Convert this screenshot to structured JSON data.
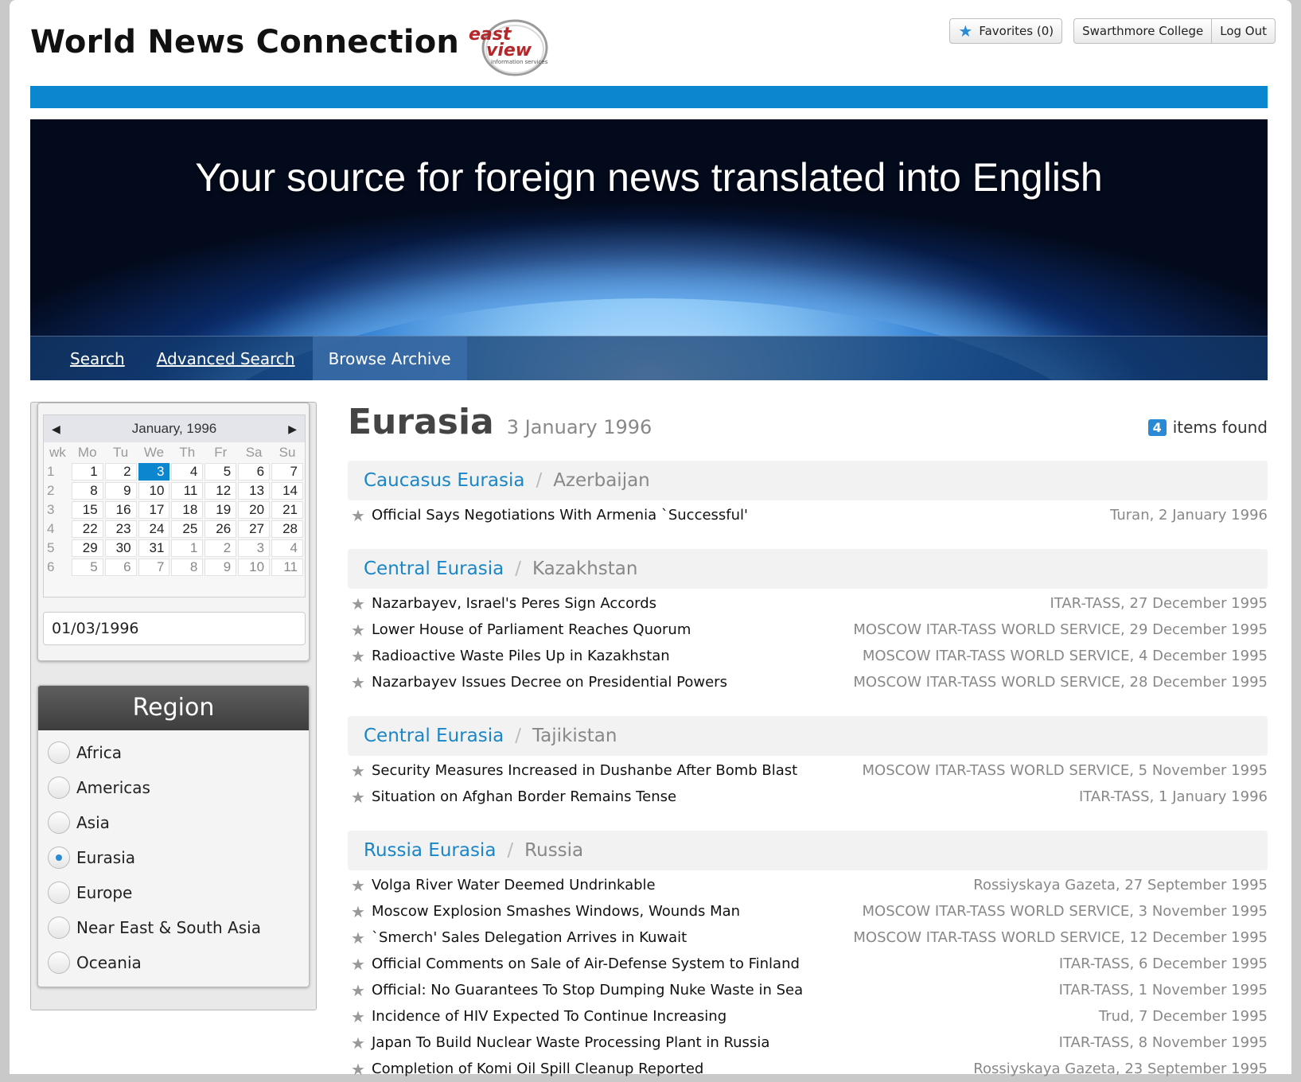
{
  "header": {
    "site_title": "World News Connection",
    "logo_text_1": "east",
    "logo_text_2": "view",
    "logo_text_3": "information services",
    "favorites_label": "Favorites (0)",
    "institution_label": "Swarthmore College",
    "logout_label": "Log Out"
  },
  "banner": {
    "tagline": "Your source for foreign news translated into English"
  },
  "nav": {
    "search": "Search",
    "advanced_search": "Advanced Search",
    "browse_archive": "Browse Archive"
  },
  "calendar": {
    "month_label": "January, 1996",
    "prev_icon": "triangle-left-icon",
    "next_icon": "triangle-right-icon",
    "headers": [
      "wk",
      "Mo",
      "Tu",
      "We",
      "Th",
      "Fr",
      "Sa",
      "Su"
    ],
    "weeks": [
      {
        "wk": "1",
        "days": [
          "1",
          "2",
          "3",
          "4",
          "5",
          "6",
          "7"
        ]
      },
      {
        "wk": "2",
        "days": [
          "8",
          "9",
          "10",
          "11",
          "12",
          "13",
          "14"
        ]
      },
      {
        "wk": "3",
        "days": [
          "15",
          "16",
          "17",
          "18",
          "19",
          "20",
          "21"
        ]
      },
      {
        "wk": "4",
        "days": [
          "22",
          "23",
          "24",
          "25",
          "26",
          "27",
          "28"
        ]
      },
      {
        "wk": "5",
        "days": [
          "29",
          "30",
          "31",
          "1",
          "2",
          "3",
          "4"
        ]
      },
      {
        "wk": "6",
        "days": [
          "5",
          "6",
          "7",
          "8",
          "9",
          "10",
          "11"
        ]
      }
    ],
    "selected_day": "3",
    "date_input_value": "01/03/1996"
  },
  "region": {
    "title": "Region",
    "options": [
      "Africa",
      "Americas",
      "Asia",
      "Eurasia",
      "Europe",
      "Near East & South Asia",
      "Oceania"
    ],
    "selected": "Eurasia"
  },
  "main": {
    "title": "Eurasia",
    "date": "3 January 1996",
    "items_count": "4",
    "items_found_label": "items found",
    "groups": [
      {
        "region": "Caucasus Eurasia",
        "country": "Azerbaijan",
        "articles": [
          {
            "title": "Official Says Negotiations With Armenia `Successful'",
            "source": "Turan, 2 January 1996"
          }
        ]
      },
      {
        "region": "Central Eurasia",
        "country": "Kazakhstan",
        "articles": [
          {
            "title": "Nazarbayev, Israel's Peres Sign Accords",
            "source": "ITAR-TASS, 27 December 1995"
          },
          {
            "title": "Lower House of Parliament Reaches Quorum",
            "source": "MOSCOW ITAR-TASS WORLD SERVICE, 29 December 1995"
          },
          {
            "title": "Radioactive Waste Piles Up in Kazakhstan",
            "source": "MOSCOW ITAR-TASS WORLD SERVICE, 4 December 1995"
          },
          {
            "title": "Nazarbayev Issues Decree on Presidential Powers",
            "source": "MOSCOW ITAR-TASS WORLD SERVICE, 28 December 1995"
          }
        ]
      },
      {
        "region": "Central Eurasia",
        "country": "Tajikistan",
        "articles": [
          {
            "title": "Security Measures Increased in Dushanbe After Bomb Blast",
            "source": "MOSCOW ITAR-TASS WORLD SERVICE, 5 November 1995"
          },
          {
            "title": "Situation on Afghan Border Remains Tense",
            "source": "ITAR-TASS, 1 January 1996"
          }
        ]
      },
      {
        "region": "Russia Eurasia",
        "country": "Russia",
        "articles": [
          {
            "title": "Volga River Water Deemed Undrinkable",
            "source": "Rossiyskaya Gazeta, 27 September 1995"
          },
          {
            "title": "Moscow Explosion Smashes Windows, Wounds Man",
            "source": "MOSCOW ITAR-TASS WORLD SERVICE, 3 November 1995"
          },
          {
            "title": "`Smerch' Sales Delegation Arrives in Kuwait",
            "source": "MOSCOW ITAR-TASS WORLD SERVICE, 12 December 1995"
          },
          {
            "title": "Official Comments on Sale of Air-Defense System to Finland",
            "source": "ITAR-TASS, 6 December 1995"
          },
          {
            "title": "Official: No Guarantees To Stop Dumping Nuke Waste in Sea",
            "source": "ITAR-TASS, 1 November 1995"
          },
          {
            "title": "Incidence of HIV Expected To Continue Increasing",
            "source": "Trud, 7 December 1995"
          },
          {
            "title": "Japan To Build Nuclear Waste Processing Plant in Russia",
            "source": "ITAR-TASS, 8 November 1995"
          },
          {
            "title": "Completion of Komi Oil Spill Cleanup Reported",
            "source": "Rossiyskaya Gazeta, 23 September 1995"
          }
        ]
      }
    ]
  },
  "colors": {
    "accent_blue": "#0a87cf",
    "link_blue": "#1a86c7",
    "logo_red": "#b3262a"
  }
}
